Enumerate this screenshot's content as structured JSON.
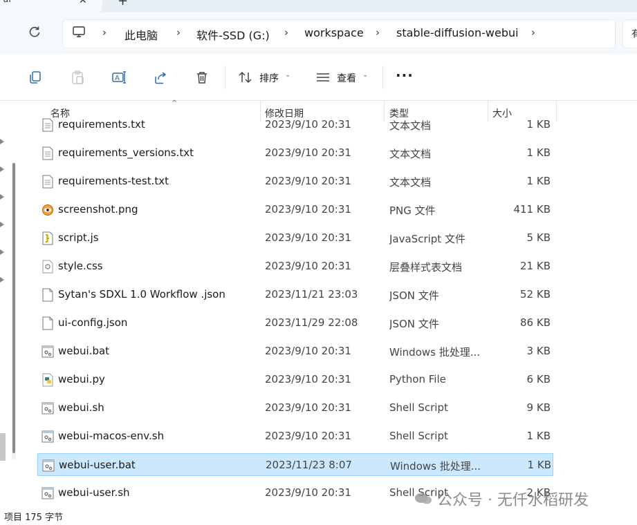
{
  "tab": {
    "title": "ui",
    "close": "✕",
    "new": "+"
  },
  "address": {
    "crumbs": [
      "此电脑",
      "软件-SSD (G:)",
      "workspace",
      "stable-diffusion-webui"
    ],
    "separator": "›",
    "right_fragment": "有"
  },
  "toolbar": {
    "sort_label": "排序",
    "view_label": "查看",
    "more": "···"
  },
  "columns": {
    "name": "名称",
    "date": "修改日期",
    "type": "类型",
    "size": "大小"
  },
  "files": [
    {
      "name": "requirements.txt",
      "date": "2023/9/10 20:31",
      "type": "文本文档",
      "size": "1 KB",
      "icon": "text-file-icon"
    },
    {
      "name": "requirements_versions.txt",
      "date": "2023/9/10 20:31",
      "type": "文本文档",
      "size": "1 KB",
      "icon": "text-file-icon"
    },
    {
      "name": "requirements-test.txt",
      "date": "2023/9/10 20:31",
      "type": "文本文档",
      "size": "1 KB",
      "icon": "text-file-icon"
    },
    {
      "name": "screenshot.png",
      "date": "2023/9/10 20:31",
      "type": "PNG 文件",
      "size": "411 KB",
      "icon": "image-file-icon"
    },
    {
      "name": "script.js",
      "date": "2023/9/10 20:31",
      "type": "JavaScript 文件",
      "size": "5 KB",
      "icon": "script-file-icon"
    },
    {
      "name": "style.css",
      "date": "2023/9/10 20:31",
      "type": "层叠样式表文档",
      "size": "21 KB",
      "icon": "css-file-icon"
    },
    {
      "name": "Sytan's SDXL 1.0 Workflow .json",
      "date": "2023/11/21 23:03",
      "type": "JSON 文件",
      "size": "52 KB",
      "icon": "blank-file-icon"
    },
    {
      "name": "ui-config.json",
      "date": "2023/11/29 22:08",
      "type": "JSON 文件",
      "size": "86 KB",
      "icon": "blank-file-icon"
    },
    {
      "name": "webui.bat",
      "date": "2023/9/10 20:31",
      "type": "Windows 批处理...",
      "size": "3 KB",
      "icon": "batch-file-icon"
    },
    {
      "name": "webui.py",
      "date": "2023/9/10 20:31",
      "type": "Python File",
      "size": "6 KB",
      "icon": "python-file-icon"
    },
    {
      "name": "webui.sh",
      "date": "2023/9/10 20:31",
      "type": "Shell Script",
      "size": "9 KB",
      "icon": "shell-file-icon"
    },
    {
      "name": "webui-macos-env.sh",
      "date": "2023/9/10 20:31",
      "type": "Shell Script",
      "size": "1 KB",
      "icon": "shell-file-icon"
    },
    {
      "name": "webui-user.bat",
      "date": "2023/11/23 8:07",
      "type": "Windows 批处理...",
      "size": "1 KB",
      "icon": "batch-file-icon",
      "selected": true
    },
    {
      "name": "webui-user.sh",
      "date": "2023/9/10 20:31",
      "type": "Shell Script",
      "size": "2 KB",
      "icon": "shell-file-icon"
    }
  ],
  "status": {
    "text": "项目  175 字节"
  },
  "watermark": {
    "text": "公众号 · 无仟水稻研发"
  },
  "colors": {
    "selection": "#cce8ff",
    "selection_border": "#99d1ff",
    "chrome": "#f6f9fb"
  }
}
